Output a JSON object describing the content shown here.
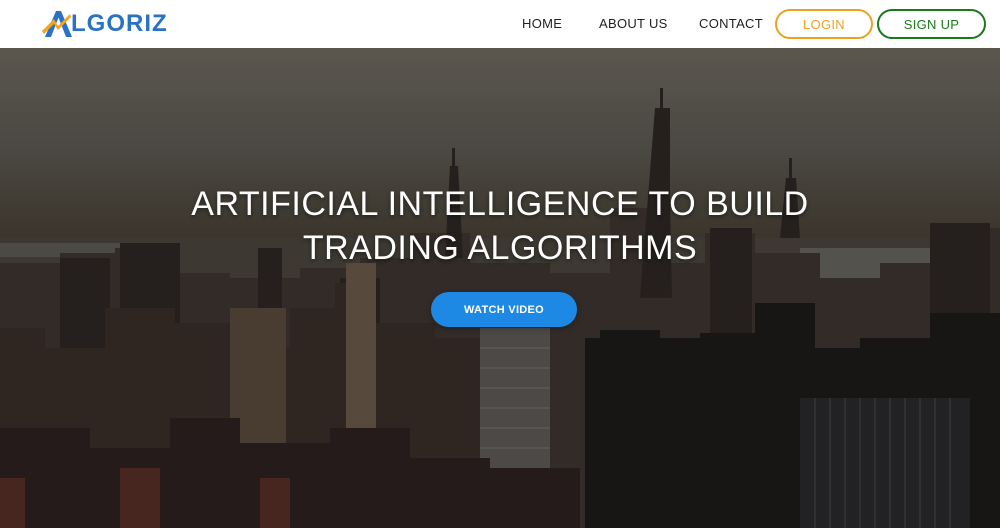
{
  "brand": {
    "name": "LGORIZ",
    "logo_icon": "algoriz-a-mark-icon",
    "color": "#2a72c6"
  },
  "nav": {
    "home": "HOME",
    "about": "ABOUT US",
    "contact": "CONTACT",
    "login": "LOGIN",
    "signup": "SIGN UP",
    "login_color": "#f0a020",
    "signup_color": "#1a7a1a"
  },
  "hero": {
    "title_line1": "ARTIFICIAL INTELLIGENCE TO BUILD",
    "title_line2": "TRADING ALGORITHMS",
    "cta_label": "WATCH VIDEO",
    "cta_color": "#1e88e5",
    "background": "city-skyline-photo"
  }
}
